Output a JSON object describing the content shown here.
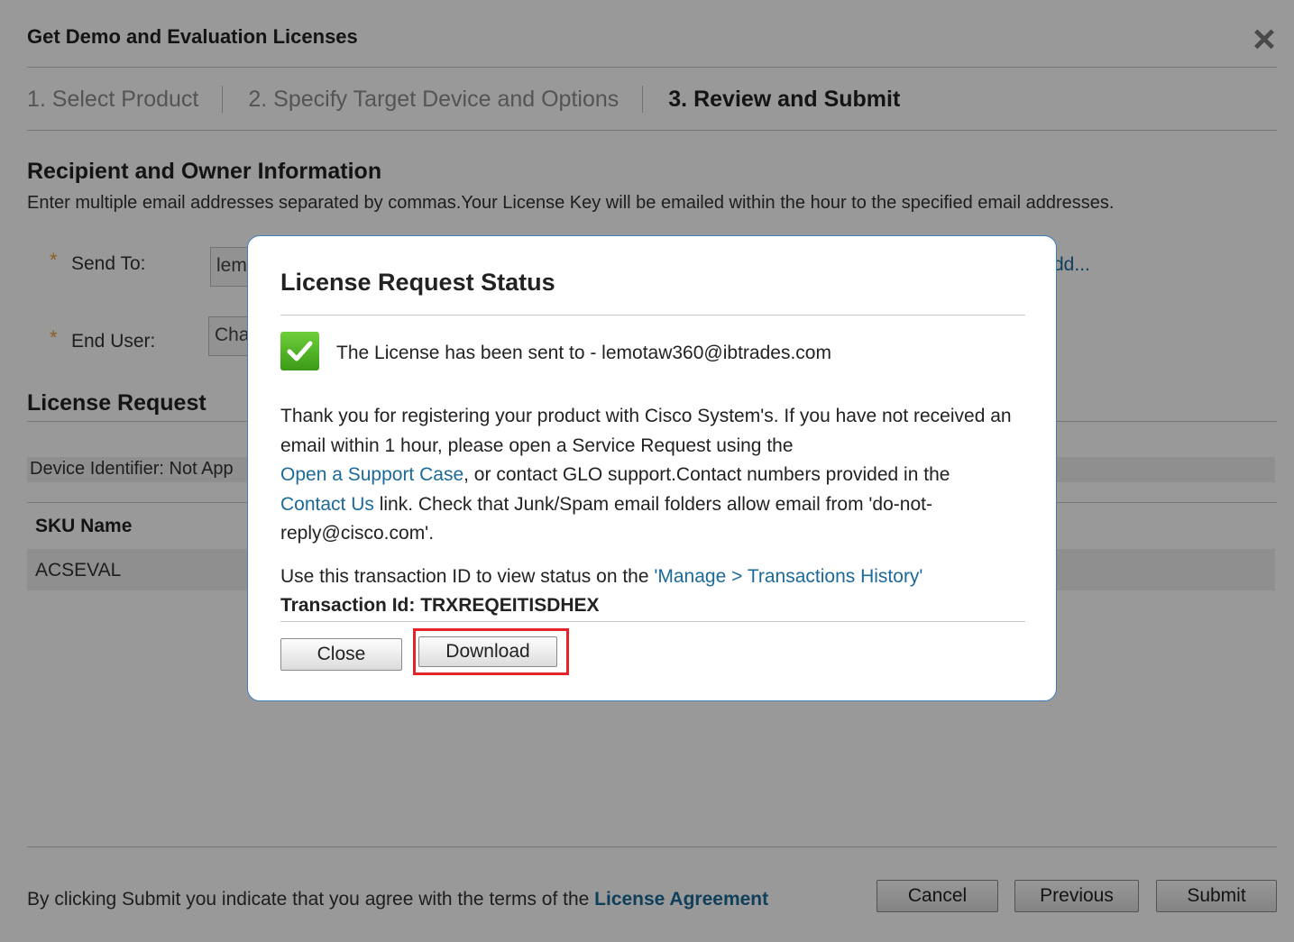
{
  "window": {
    "title": "Get Demo and Evaluation Licenses",
    "close_icon": "×"
  },
  "steps": [
    {
      "label": "1. Select Product"
    },
    {
      "label": "2. Specify Target Device and Options"
    },
    {
      "label": "3. Review and Submit"
    }
  ],
  "recipient": {
    "heading": "Recipient and Owner Information",
    "description": "Enter multiple email addresses separated by commas.Your License Key will be emailed within the hour to the specified email addresses.",
    "required_mark": "*",
    "send_to_label": "Send To:",
    "send_to_value": "lem",
    "add_link": "dd...",
    "end_user_label": "End User:",
    "end_user_value": "Cha"
  },
  "license_request": {
    "heading": "License Request",
    "device_identifier": "Device Identifier: Not App",
    "sku_header": "SKU Name",
    "sku_value": "ACSEVAL"
  },
  "footer": {
    "agree_text": "By clicking Submit you indicate that you agree with the terms of the ",
    "agree_link": "License Agreement",
    "cancel": "Cancel",
    "previous": "Previous",
    "submit": "Submit"
  },
  "modal": {
    "title": "License Request Status",
    "sent_text": "The License has been sent to - lemotaw360@ibtrades.com",
    "para_1": "Thank you for registering your product with Cisco System's. If you have not received an email within 1 hour, please open a Service Request using the",
    "link_support": "Open a Support Case",
    "para_2": ", or contact GLO support.Contact numbers provided in the",
    "link_contact": "Contact Us",
    "para_3": " link. Check that Junk/Spam email folders allow email from 'do-not-reply@cisco.com'.",
    "transaction_text": "Use this transaction ID to view status on the ",
    "transaction_link": "'Manage > Transactions History'",
    "transaction_id": "Transaction Id: TRXREQEITISDHEX",
    "close_button": "Close",
    "download_button": "Download"
  },
  "colors": {
    "link": "#1b6a9a",
    "highlight": "#e5232a",
    "check": "#4caf28"
  }
}
